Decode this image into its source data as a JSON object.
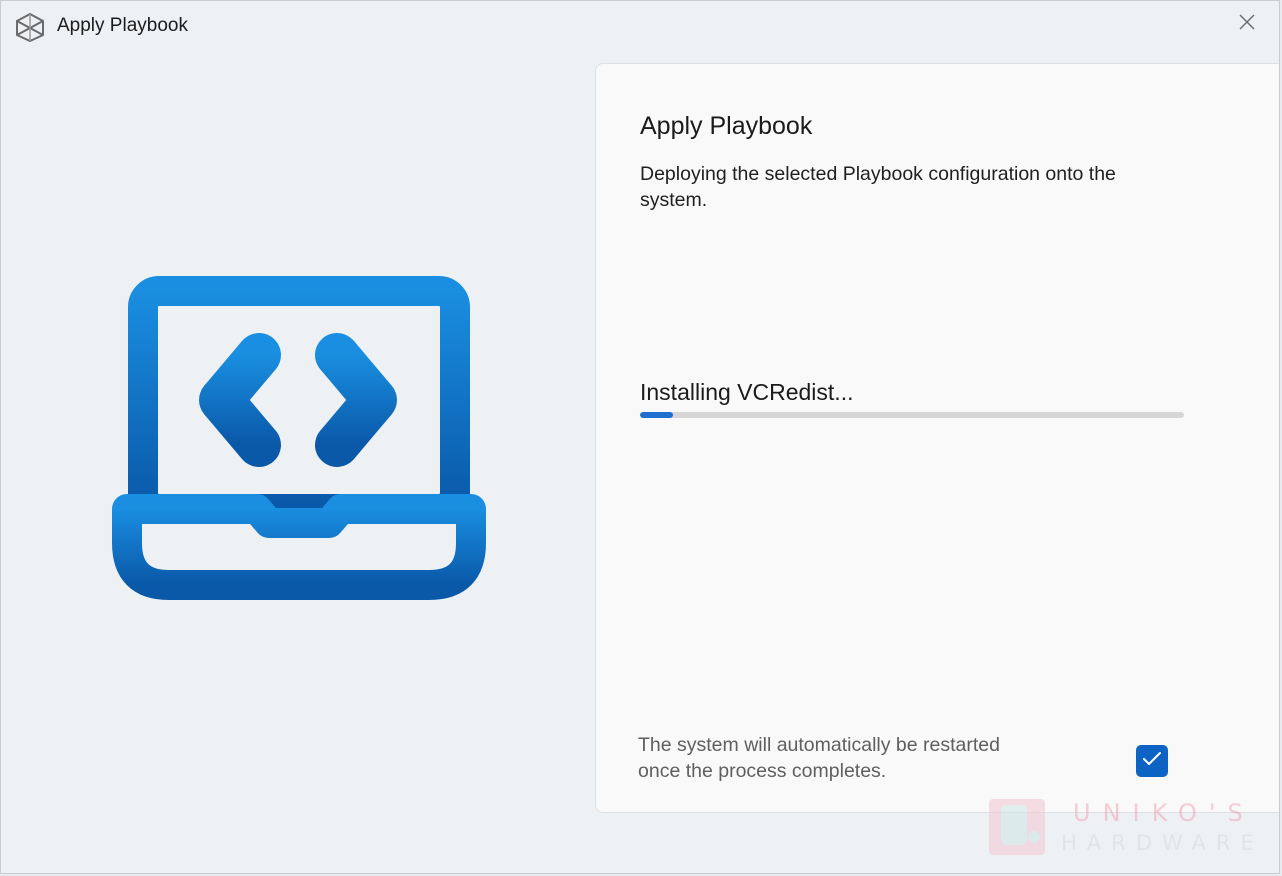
{
  "window": {
    "title": "Apply Playbook",
    "close_icon": "close-icon",
    "app_icon": "playbook-cube-icon"
  },
  "illustration": {
    "icon": "laptop-code-icon",
    "color": "#1466b8"
  },
  "panel": {
    "title": "Apply Playbook",
    "description": "Deploying the selected Playbook configuration onto the system.",
    "status": "Installing VCRedist...",
    "progress_percent": 6,
    "restart_note": "The system will automatically be restarted once the process completes.",
    "restart_checked": true,
    "accent_color": "#0d63c4"
  },
  "watermark": {
    "top_text": "UNIKO'S",
    "bottom_text": "HARDWARE"
  }
}
